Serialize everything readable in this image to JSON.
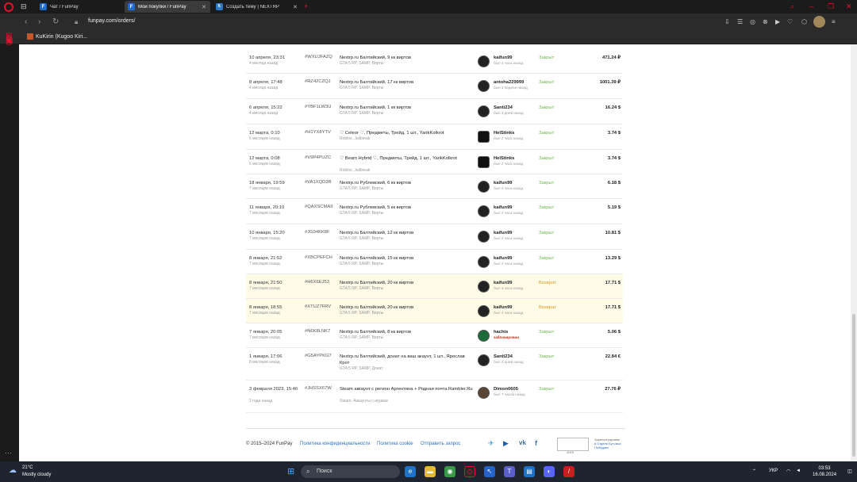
{
  "browser": {
    "tabs": [
      {
        "label": "Чат / FunPay",
        "icon": "F"
      },
      {
        "label": "Мои покупки / FunPay",
        "icon": "F"
      },
      {
        "label": "Создать тему | NEXTRP",
        "icon": "ᥰ"
      }
    ],
    "url": "funpay.com/orders/",
    "bookmark": "KuKirin (Kugoo Kiri..."
  },
  "orders": [
    {
      "date": "10 апреля, 23:31",
      "ago": "4 месяца назад",
      "id": "#WXUJFAZQ",
      "title": "Nextrp.ru Балтийский, 9 кк виртов",
      "category": "GTA 5 RP, SAMP, Вирты",
      "user": "kaifun99",
      "seen": "был 4 часа назад",
      "status": "Закрыт",
      "status_type": "done",
      "price": "471.24 ₽",
      "avatar": "skull-avatar"
    },
    {
      "date": "8 апреля, 17:48",
      "ago": "4 месяца назад",
      "id": "#RZ42CZQJ",
      "title": "Nextrp.ru Балтийский, 17 кк виртов",
      "category": "GTA 5 RP, SAMP, Вирты",
      "user": "antoha229999",
      "seen": "был 3 недели назад",
      "status": "Закрыт",
      "status_type": "done",
      "price": "1001.39 ₽",
      "avatar": "skull-avatar"
    },
    {
      "date": "6 апреля, 15:22",
      "ago": "4 месяца назад",
      "id": "#YBF1LW3U",
      "title": "Nextrp.ru Балтийский, 1 кк виртов",
      "category": "GTA 5 RP, SAMP, Вирты",
      "user": "Santi234",
      "seen": "был 3 дней назад",
      "status": "Закрыт",
      "status_type": "done",
      "price": "16.24 $",
      "avatar": "skull-avatar"
    },
    {
      "date": "12 марта, 0:10",
      "ago": "5 месяцев назад",
      "id": "#H1YX8YTV",
      "title": "♡ Celeor ♡, Предметы, Трейд, 1 шт., YarikKolkrot",
      "category": "Roblox, Jailbreak",
      "user": "HelStinks",
      "seen": "был 2 часа назад",
      "status": "Закрыт",
      "status_type": "done",
      "price": "3.74 $",
      "avatar": "helmet-avatar"
    },
    {
      "date": "12 марта, 0:08",
      "ago": "5 месяцев назад",
      "id": "#V9P4PUZC",
      "title": "♡ Beam Hybrid ♡, Предметы, Трейд, 1 шт., YarikKolkrot",
      "category": "Roblox, Jailbreak",
      "user": "HelStinks",
      "seen": "был 2 часа назад",
      "status": "Закрыт",
      "status_type": "done",
      "price": "3.74 $",
      "avatar": "helmet-avatar"
    },
    {
      "date": "18 января, 19:59",
      "ago": "7 месяцев назад",
      "id": "#VA1XQD3R",
      "title": "Nextrp.ru Рублевский, 6 кк виртов",
      "category": "GTA 5 RP, SAMP, Вирты",
      "user": "kaifun99",
      "seen": "был 4 часа назад",
      "status": "Закрыт",
      "status_type": "done",
      "price": "6.18 $",
      "avatar": "skull-avatar"
    },
    {
      "date": "11 января, 20:10",
      "ago": "7 месяцев назад",
      "id": "#QAXSCMA9",
      "title": "Nextrp.ru Рублевский, 5 кк виртов",
      "category": "GTA 5 RP, SAMP, Вирты",
      "user": "kaifun99",
      "seen": "был 4 часа назад",
      "status": "Закрыт",
      "status_type": "done",
      "price": "5.19 $",
      "avatar": "skull-avatar"
    },
    {
      "date": "10 января, 15:20",
      "ago": "7 месяцев назад",
      "id": "#JG94KK8F",
      "title": "Nextrp.ru Балтийский, 12 кк виртов",
      "category": "GTA 5 RP, SAMP, Вирты",
      "user": "kaifun99",
      "seen": "был 4 часа назад",
      "status": "Закрыт",
      "status_type": "done",
      "price": "10.81 $",
      "avatar": "skull-avatar"
    },
    {
      "date": "8 января, 21:52",
      "ago": "7 месяцев назад",
      "id": "#XBCPEFCH",
      "title": "Nextrp.ru Балтийский, 15 кк виртов",
      "category": "GTA 5 RP, SAMP, Вирты",
      "user": "kaifun99",
      "seen": "был 4 часа назад",
      "status": "Закрыт",
      "status_type": "done",
      "price": "13.29 $",
      "avatar": "skull-avatar"
    },
    {
      "date": "8 января, 21:50",
      "ago": "7 месяцев назад",
      "id": "#H6X6EJ53",
      "title": "Nextrp.ru Балтийский, 20 кк виртов",
      "category": "GTA 5 RP, SAMP, Вирты",
      "user": "kaifun99",
      "seen": "был 4 часа назад",
      "status": "Возврат",
      "status_type": "ret",
      "price": "17.71 $",
      "avatar": "skull-avatar"
    },
    {
      "date": "8 января, 18:55",
      "ago": "7 месяцев назад",
      "id": "#XTUZ7FRV",
      "title": "Nextrp.ru Балтийский, 20 кк виртов",
      "category": "GTA 5 RP, SAMP, Вирты",
      "user": "kaifun99",
      "seen": "был 4 часа назад",
      "status": "Возврат",
      "status_type": "ret",
      "price": "17.71 $",
      "avatar": "skull-avatar"
    },
    {
      "date": "7 января, 20:05",
      "ago": "7 месяцев назад",
      "id": "#N6K8LNK7",
      "title": "Nextrp.ru Балтийский, 8 кк виртов",
      "category": "GTA 5 RP, SAMP, Вирты",
      "user": "hachis",
      "seen": "заблокирован",
      "status": "Закрыт",
      "status_type": "done",
      "price": "5.06 $",
      "avatar": "green-avatar",
      "banned": true
    },
    {
      "date": "1 января, 17:06",
      "ago": "8 месяцев назад",
      "id": "#G5AYPKG7",
      "title": "Nextrp.ru Балтийский, донат на ваш акаунт, 1 шт., Ярослав Крот",
      "category": "GTA 5 RP, SAMP, Донат",
      "user": "Santi234",
      "seen": "был 3 дней назад",
      "status": "Закрыт",
      "status_type": "done",
      "price": "22.84 €",
      "avatar": "skull-avatar"
    },
    {
      "date": "3 февраля 2023, 15:46",
      "ago": "2 года назад",
      "id": "#JHSSX67W",
      "title": "Steam аккаунт с регион Аргентина + Родная почта Rambler.Ru",
      "category": "Steam, Аккаунты с играми",
      "user": "Dimon0605",
      "seen": "был 7 часов назад",
      "status": "Закрыт",
      "status_type": "done",
      "price": "27.76 ₽",
      "avatar": "photo-avatar"
    }
  ],
  "footer": {
    "copyright": "© 2015–2024 FunPay",
    "links": [
      "Политика конфиденциальности",
      "Политика cookie",
      "Отправить запрос"
    ],
    "social": [
      "telegram-icon",
      "youtube-icon",
      "vk-icon",
      "facebook-icon"
    ],
    "badge_caption": "2019",
    "registry": "Зарегистрирован",
    "registry_line2": "в Отделе Бутовых Победиях"
  },
  "taskbar": {
    "weather_temp": "21°C",
    "weather_desc": "Mostly cloudy",
    "search_placeholder": "Поиск",
    "lang": "УКР",
    "time": "03:53",
    "date": "16.08.2024"
  }
}
